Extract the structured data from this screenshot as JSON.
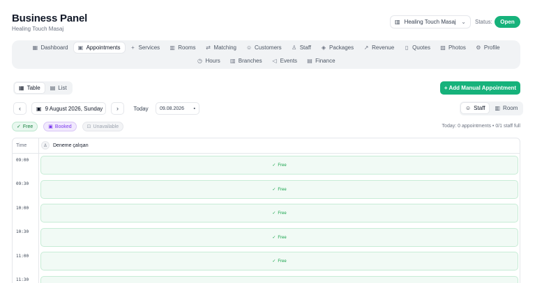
{
  "header": {
    "title": "Business Panel",
    "subtitle": "Healing Touch Masaj",
    "branch_select": "Healing Touch Masaj",
    "status_label": "Status:",
    "status_value": "Open",
    "status_color": "#16b27b"
  },
  "nav": {
    "row1": [
      {
        "label": "Dashboard",
        "icon": "grid-icon"
      },
      {
        "label": "Appointments",
        "icon": "calendar-icon",
        "active": true
      },
      {
        "label": "Services",
        "icon": "plus-icon"
      },
      {
        "label": "Rooms",
        "icon": "building-icon"
      },
      {
        "label": "Matching",
        "icon": "shuffle-icon"
      },
      {
        "label": "Customers",
        "icon": "users-icon"
      },
      {
        "label": "Staff",
        "icon": "user-check-icon"
      },
      {
        "label": "Packages",
        "icon": "package-icon"
      },
      {
        "label": "Revenue",
        "icon": "trending-icon"
      },
      {
        "label": "Quotes",
        "icon": "file-icon"
      },
      {
        "label": "Photos",
        "icon": "image-icon"
      },
      {
        "label": "Profile",
        "icon": "gear-icon"
      }
    ],
    "row2": [
      {
        "label": "Hours",
        "icon": "clock-icon"
      },
      {
        "label": "Branches",
        "icon": "building-icon"
      },
      {
        "label": "Events",
        "icon": "megaphone-icon"
      },
      {
        "label": "Finance",
        "icon": "calculator-icon"
      }
    ]
  },
  "view_toggle": {
    "table": "Table",
    "list": "List"
  },
  "add_button": "+ Add Manual Appointment",
  "date_bar": {
    "prev": "‹",
    "next": "›",
    "date_label": "9 August 2026, Sunday",
    "today": "Today",
    "date_input": "09.08.2026",
    "mode_staff": "Staff",
    "mode_room": "Room"
  },
  "legend": {
    "free": "Free",
    "booked": "Booked",
    "unavailable": "Unavailable"
  },
  "summary": "Today: 0 appointments • 0/1 staff full",
  "grid": {
    "time_header": "Time",
    "staff_name": "Deneme çalışan",
    "rows": [
      {
        "time": "09:00",
        "slot": "Free"
      },
      {
        "time": "09:30",
        "slot": "Free"
      },
      {
        "time": "10:00",
        "slot": "Free"
      },
      {
        "time": "10:30",
        "slot": "Free"
      },
      {
        "time": "11:00",
        "slot": "Free"
      },
      {
        "time": "11:30",
        "slot": ""
      }
    ]
  }
}
